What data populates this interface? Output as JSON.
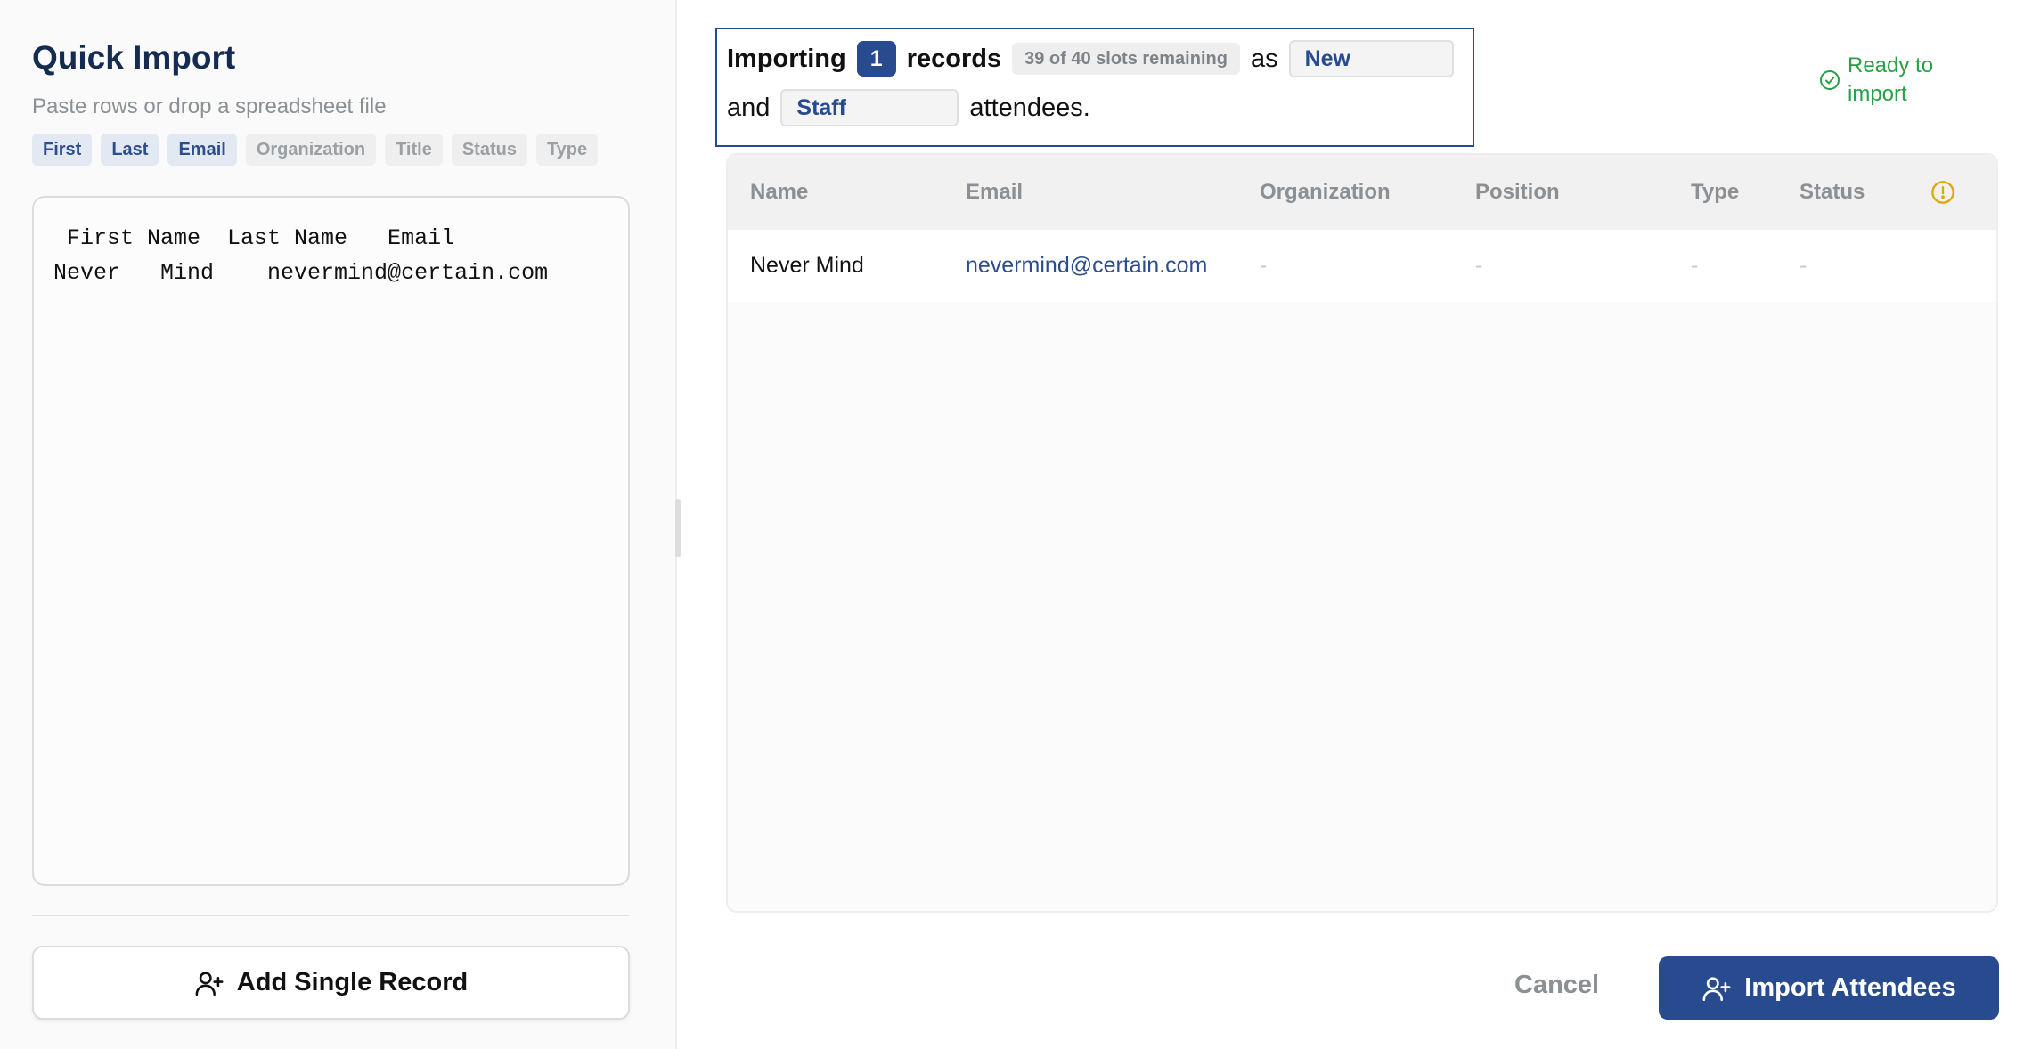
{
  "left_panel": {
    "title": "Quick Import",
    "subtitle": "Paste rows or drop a spreadsheet file",
    "chips": [
      {
        "label": "First",
        "active": true
      },
      {
        "label": "Last",
        "active": true
      },
      {
        "label": "Email",
        "active": true
      },
      {
        "label": "Organization",
        "active": false
      },
      {
        "label": "Title",
        "active": false
      },
      {
        "label": "Status",
        "active": false
      },
      {
        "label": "Type",
        "active": false
      }
    ],
    "paste_text": " First Name  Last Name   Email\nNever   Mind    nevermind@certain.com",
    "add_button_label": "Add Single Record",
    "add_button_icon": "user-plus-icon"
  },
  "header": {
    "importing_word": "Importing",
    "count": "1",
    "records_word": "records",
    "slots_text": "39 of 40 slots remaining",
    "as_word": "as",
    "status_value": "New",
    "and_word": "and",
    "type_value": "Staff",
    "attendees_word": "attendees.",
    "ready_text": "Ready to import",
    "ready_icon": "check-circle-icon"
  },
  "table": {
    "columns": [
      "Name",
      "Email",
      "Organization",
      "Position",
      "Type",
      "Status"
    ],
    "warning_icon": "alert-circle-icon",
    "rows": [
      {
        "name": "Never Mind",
        "email": "nevermind@certain.com",
        "organization": "-",
        "position": "-",
        "type": "-",
        "status": "-"
      }
    ]
  },
  "footer": {
    "cancel_label": "Cancel",
    "import_label": "Import Attendees",
    "import_icon": "user-plus-icon"
  },
  "colors": {
    "primary": "#274b8e",
    "title": "#142b52",
    "ready": "#27a046",
    "warning": "#e0a800",
    "muted": "#8a9094"
  }
}
